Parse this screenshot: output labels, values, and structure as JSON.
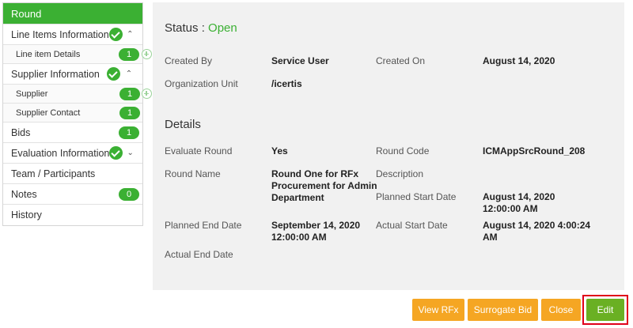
{
  "sidebar": {
    "round": "Round",
    "line_items": "Line Items Information",
    "line_item_details": "Line item Details",
    "line_item_details_count": "1",
    "supplier_info": "Supplier Information",
    "supplier": "Supplier",
    "supplier_count": "1",
    "supplier_contact": "Supplier Contact",
    "supplier_contact_count": "1",
    "bids": "Bids",
    "bids_count": "1",
    "evaluation": "Evaluation Information",
    "team": "Team / Participants",
    "notes": "Notes",
    "notes_count": "0",
    "history": "History"
  },
  "status": {
    "label": "Status :",
    "value": "Open"
  },
  "general": {
    "created_by_label": "Created By",
    "created_by": "Service User",
    "created_on_label": "Created On",
    "created_on": "August 14, 2020",
    "org_unit_label": "Organization Unit",
    "org_unit": "/icertis"
  },
  "details": {
    "title": "Details",
    "evaluate_round_label": "Evaluate Round",
    "evaluate_round": "Yes",
    "round_code_label": "Round Code",
    "round_code": "ICMAppSrcRound_208",
    "round_name_label": "Round Name",
    "round_name_1": "Round One for RFx",
    "round_name_2": "Procurement for Admin",
    "round_name_3": "Department",
    "description_label": "Description",
    "planned_start_label": "Planned Start Date",
    "planned_start_1": "August 14, 2020",
    "planned_start_2": "12:00:00 AM",
    "planned_end_label": "Planned End Date",
    "planned_end_1": "September 14, 2020",
    "planned_end_2": "12:00:00 AM",
    "actual_start_label": "Actual Start Date",
    "actual_start_1": "August 14, 2020 4:00:24",
    "actual_start_2": "AM",
    "actual_end_label": "Actual End Date"
  },
  "buttons": {
    "view_rfx": "View RFx",
    "surrogate_bid": "Surrogate Bid",
    "close": "Close",
    "edit": "Edit"
  },
  "colors": {
    "accent_green": "#3bb033",
    "button_orange": "#f5a623",
    "edit_green": "#6ab023",
    "highlight_red": "#e0001a"
  },
  "icons": [
    "check-icon",
    "chevron-up-icon",
    "chevron-down-icon",
    "add-icon"
  ]
}
